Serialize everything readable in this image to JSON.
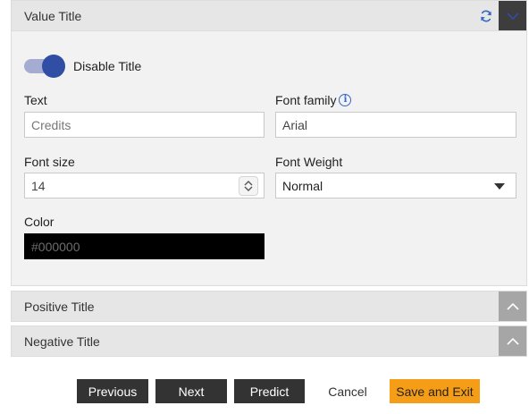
{
  "value_title_section": {
    "title": "Value Title",
    "refresh_icon": "refresh-icon",
    "collapse_icon": "chevron-down-icon",
    "disable_toggle": {
      "label": "Disable Title",
      "on": true
    },
    "text_field": {
      "label": "Text",
      "value": "Credits"
    },
    "font_family_field": {
      "label": "Font family",
      "value": "Arial",
      "info_icon": "info-icon"
    },
    "font_size_field": {
      "label": "Font size",
      "value": "14"
    },
    "font_weight_field": {
      "label": "Font Weight",
      "value": "Normal"
    },
    "color_field": {
      "label": "Color",
      "value": "#000000"
    }
  },
  "positive_title_section": {
    "title": "Positive Title",
    "expand_icon": "chevron-up-icon"
  },
  "negative_title_section": {
    "title": "Negative Title",
    "expand_icon": "chevron-up-icon"
  },
  "footer": {
    "previous_label": "Previous",
    "next_label": "Next",
    "predict_label": "Predict",
    "cancel_label": "Cancel",
    "save_exit_label": "Save and Exit"
  },
  "colors": {
    "accent_blue": "#2f4ea4",
    "save_orange": "#f59d16",
    "dark_button": "#333333"
  }
}
